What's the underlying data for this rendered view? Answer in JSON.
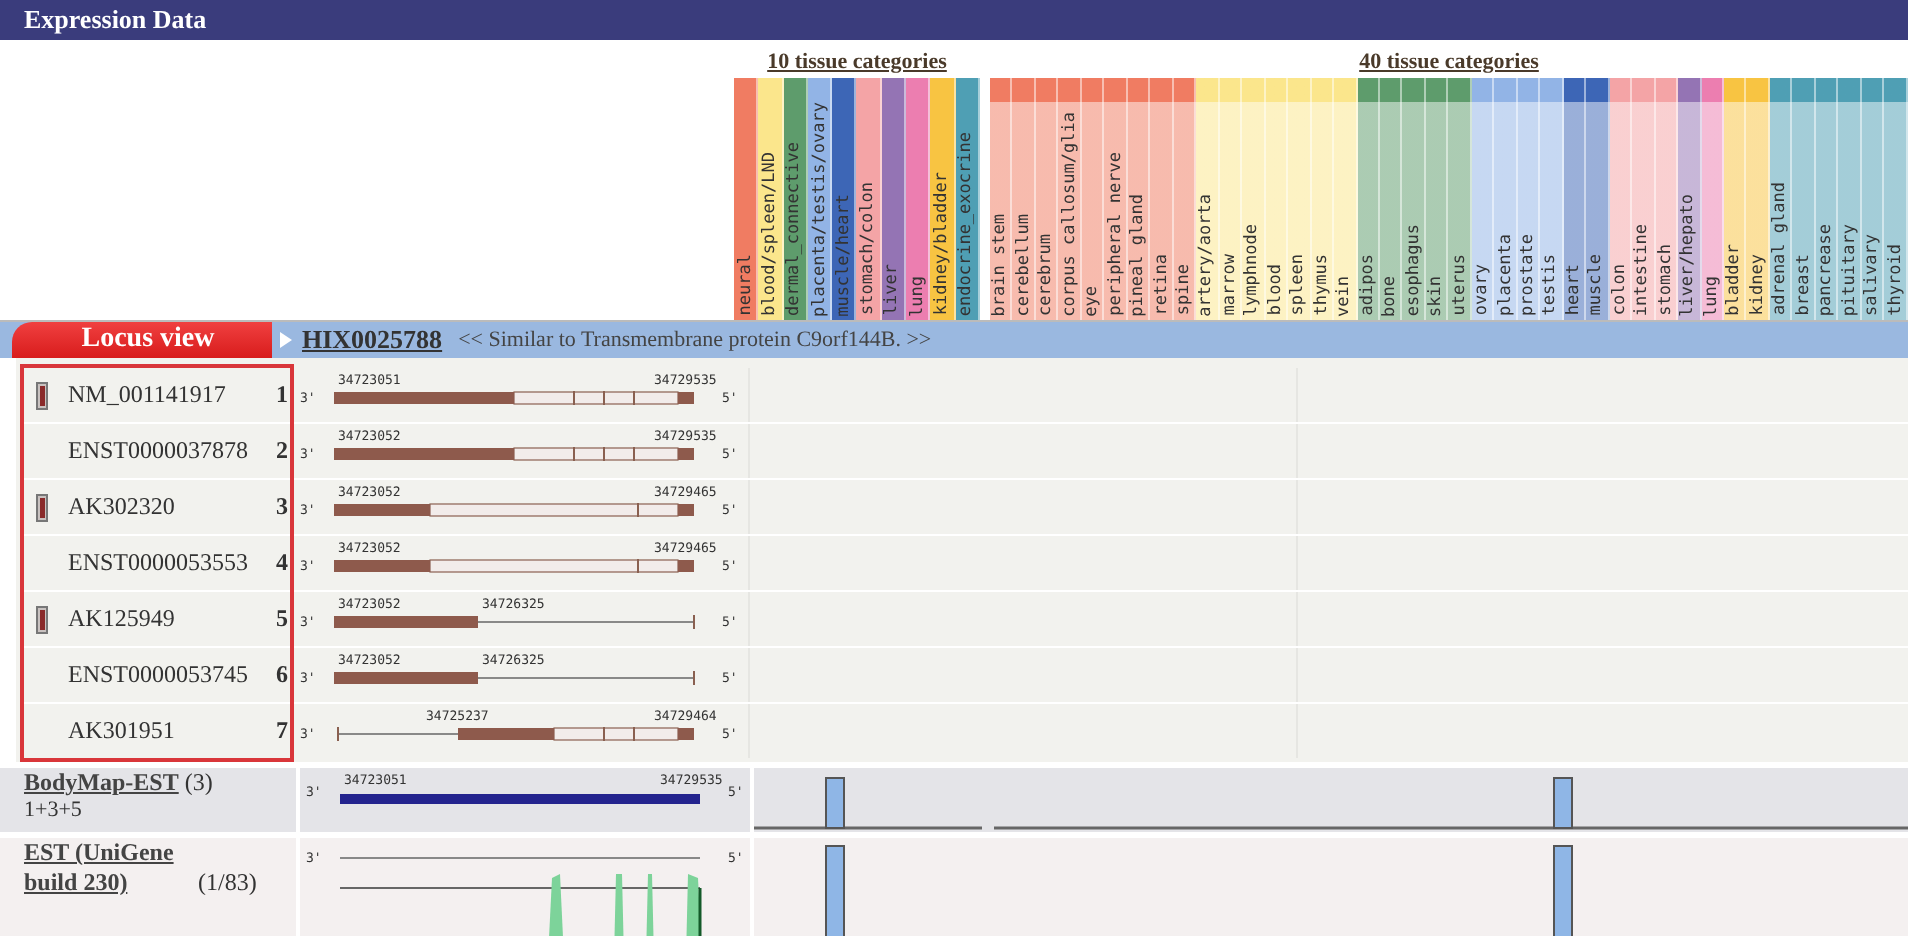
{
  "panel": {
    "title": "Expression Data"
  },
  "categories_10": {
    "title": "10 tissue categories",
    "columns": [
      {
        "label": "neural",
        "color": "#f07c62"
      },
      {
        "label": "blood/spleen/LND",
        "color": "#fbe68c"
      },
      {
        "label": "dermal_connective",
        "color": "#5e9c6c"
      },
      {
        "label": "placenta/testis/ovary",
        "color": "#92b4e6"
      },
      {
        "label": "muscle/heart",
        "color": "#3d66b6"
      },
      {
        "label": "stomach/colon",
        "color": "#f4a4a6"
      },
      {
        "label": "liver",
        "color": "#9474b4"
      },
      {
        "label": "lung",
        "color": "#ec7eb0"
      },
      {
        "label": "kidney/bladder",
        "color": "#f8c442"
      },
      {
        "label": "endocrine_exocrine",
        "color": "#4f9fb4"
      }
    ]
  },
  "categories_40": {
    "title": "40 tissue categories",
    "columns": [
      {
        "label": "brain stem",
        "color": "#f07c62"
      },
      {
        "label": "cerebellum",
        "color": "#f07c62"
      },
      {
        "label": "cerebrum",
        "color": "#f07c62"
      },
      {
        "label": "corpus callosum/glia",
        "color": "#f07c62"
      },
      {
        "label": "eye",
        "color": "#f07c62"
      },
      {
        "label": "peripheral nerve",
        "color": "#f07c62"
      },
      {
        "label": "pineal gland",
        "color": "#f07c62"
      },
      {
        "label": "retina",
        "color": "#f07c62"
      },
      {
        "label": "spine",
        "color": "#f07c62"
      },
      {
        "label": "artery/aorta",
        "color": "#fbe68c"
      },
      {
        "label": "marrow",
        "color": "#fbe68c"
      },
      {
        "label": "lymphnode",
        "color": "#fbe68c"
      },
      {
        "label": "blood",
        "color": "#fbe68c"
      },
      {
        "label": "spleen",
        "color": "#fbe68c"
      },
      {
        "label": "thymus",
        "color": "#fbe68c"
      },
      {
        "label": "vein",
        "color": "#fbe68c"
      },
      {
        "label": "adipos",
        "color": "#5e9c6c"
      },
      {
        "label": "bone",
        "color": "#5e9c6c"
      },
      {
        "label": "esophagus",
        "color": "#5e9c6c"
      },
      {
        "label": "skin",
        "color": "#5e9c6c"
      },
      {
        "label": "uterus",
        "color": "#5e9c6c"
      },
      {
        "label": "ovary",
        "color": "#92b4e6"
      },
      {
        "label": "placenta",
        "color": "#92b4e6"
      },
      {
        "label": "prostate",
        "color": "#92b4e6"
      },
      {
        "label": "testis",
        "color": "#92b4e6"
      },
      {
        "label": "heart",
        "color": "#3d66b6"
      },
      {
        "label": "muscle",
        "color": "#3d66b6"
      },
      {
        "label": "colon",
        "color": "#f4a4a6"
      },
      {
        "label": "intestine",
        "color": "#f4a4a6"
      },
      {
        "label": "stomach",
        "color": "#f4a4a6"
      },
      {
        "label": "liver/hepato",
        "color": "#9474b4"
      },
      {
        "label": "lung",
        "color": "#ec7eb0"
      },
      {
        "label": "bladder",
        "color": "#f8c442"
      },
      {
        "label": "kidney",
        "color": "#f8c442"
      },
      {
        "label": "adrenal gland",
        "color": "#4f9fb4"
      },
      {
        "label": "breast",
        "color": "#4f9fb4"
      },
      {
        "label": "pancrease",
        "color": "#4f9fb4"
      },
      {
        "label": "pituitary",
        "color": "#4f9fb4"
      },
      {
        "label": "salivary",
        "color": "#4f9fb4"
      },
      {
        "label": "thyroid",
        "color": "#4f9fb4"
      }
    ]
  },
  "locus": {
    "tab": "Locus view",
    "gene_id": "HIX0025788",
    "description": "<< Similar to Transmembrane protein C9orf144B. >>"
  },
  "transcripts": [
    {
      "name": "NM_001141917",
      "number": "1",
      "marked": true,
      "kind": "full",
      "start": "34723051",
      "end": "34729535",
      "strand_left": "3'",
      "strand_right": "5'"
    },
    {
      "name": "ENST0000037878",
      "number": "2",
      "marked": false,
      "kind": "full",
      "start": "34723052",
      "end": "34729535",
      "strand_left": "3'",
      "strand_right": "5'"
    },
    {
      "name": "AK302320",
      "number": "3",
      "marked": true,
      "kind": "short",
      "start": "34723052",
      "end": "34729465",
      "strand_left": "3'",
      "strand_right": "5'"
    },
    {
      "name": "ENST0000053553",
      "number": "4",
      "marked": false,
      "kind": "short",
      "start": "34723052",
      "end": "34729465",
      "strand_left": "3'",
      "strand_right": "5'"
    },
    {
      "name": "AK125949",
      "number": "5",
      "marked": true,
      "kind": "truncated",
      "start": "34723052",
      "end": "34726325",
      "strand_left": "3'",
      "strand_right": "5'"
    },
    {
      "name": "ENST0000053745",
      "number": "6",
      "marked": false,
      "kind": "truncated",
      "start": "34723052",
      "end": "34726325",
      "strand_left": "3'",
      "strand_right": "5'"
    },
    {
      "name": "AK301951",
      "number": "7",
      "marked": false,
      "kind": "partial",
      "start": "34725237",
      "end": "34729464",
      "strand_left": "3'",
      "strand_right": "5'"
    }
  ],
  "bodymap": {
    "link": "BodyMap-EST",
    "count": "(3)",
    "members": "1+3+5",
    "start": "34723051",
    "end": "34729535",
    "strand_left": "3'",
    "strand_right": "5'"
  },
  "est": {
    "link": "EST (UniGene build 230)",
    "count": "(1/83)",
    "strand_left": "3'",
    "strand_right": "5'"
  }
}
